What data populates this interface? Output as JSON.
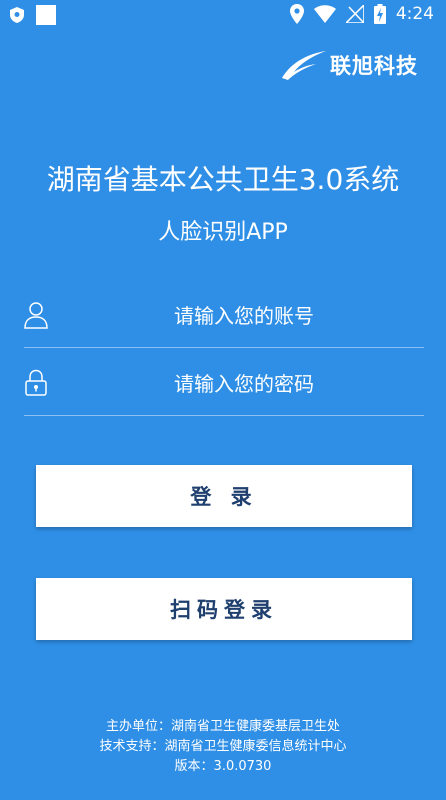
{
  "status_bar": {
    "time": "4:24",
    "icons": [
      "shield-icon",
      "notification-icon",
      "location-icon",
      "wifi-icon",
      "no-signal-icon",
      "battery-charging-icon"
    ]
  },
  "brand": {
    "name": "联旭科技",
    "icon": "brand-logo-icon"
  },
  "header": {
    "title": "湖南省基本公共卫生3.0系统",
    "subtitle": "人脸识别APP"
  },
  "form": {
    "account_placeholder": "请输入您的账号",
    "account_value": "",
    "password_placeholder": "请输入您的密码",
    "password_value": "",
    "account_icon": "user-icon",
    "password_icon": "lock-icon"
  },
  "buttons": {
    "login_label": "登 录",
    "scan_login_label": "扫码登录"
  },
  "footer": {
    "organizer": "主办单位：湖南省卫生健康委基层卫生处",
    "tech_support": "技术支持：湖南省卫生健康委信息统计中心",
    "version": "版本：3.0.0730"
  },
  "colors": {
    "background": "#2f8fe6",
    "button_bg": "#ffffff",
    "button_text": "#1f3f6e"
  }
}
